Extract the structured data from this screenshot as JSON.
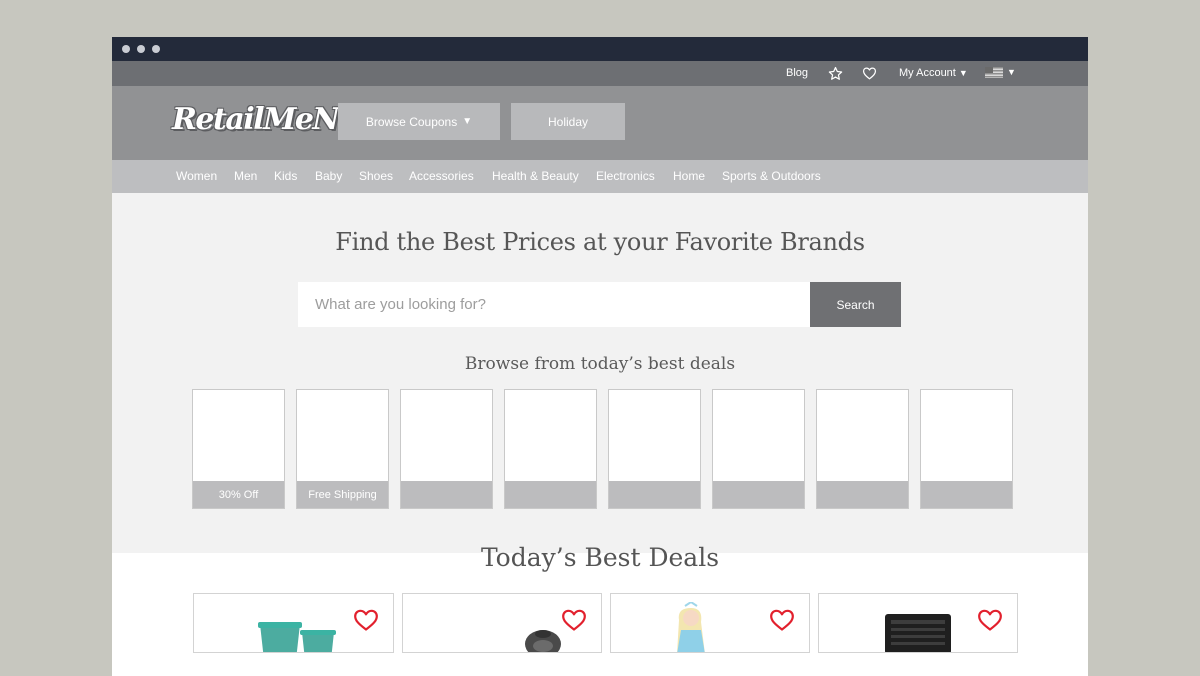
{
  "browser": {
    "dots": [
      "dot",
      "dot",
      "dot"
    ]
  },
  "utility": {
    "blog": "Blog",
    "account": "My Account",
    "account_caret": "▼",
    "flag_caret": "▼"
  },
  "header": {
    "logo": "RetailMeNot",
    "browse_button": "Browse Coupons",
    "browse_caret": "▼",
    "holiday_button": "Holiday"
  },
  "categories": [
    "Women",
    "Men",
    "Kids",
    "Baby",
    "Shoes",
    "Accessories",
    "Health & Beauty",
    "Electronics",
    "Home",
    "Sports & Outdoors"
  ],
  "hero": {
    "title": "Find the Best Prices at your Favorite Brands",
    "search_placeholder": "What are you looking for?",
    "search_button": "Search",
    "browse_subtitle": "Browse from today’s best deals"
  },
  "deal_tiles": [
    "30% Off",
    "Free Shipping",
    "",
    "",
    "",
    "",
    "",
    ""
  ],
  "deals": {
    "title": "Today’s Best Deals",
    "cards": [
      {
        "product": "tumblers-image",
        "heart_icon": "heart-icon"
      },
      {
        "product": "cookware-image",
        "heart_icon": "heart-icon"
      },
      {
        "product": "doll-image",
        "heart_icon": "heart-icon"
      },
      {
        "product": "camera-lens-image",
        "heart_icon": "heart-icon"
      }
    ]
  },
  "colors": {
    "heart": "#e2202d",
    "topbar": "#232a3a",
    "header": "#919294"
  }
}
